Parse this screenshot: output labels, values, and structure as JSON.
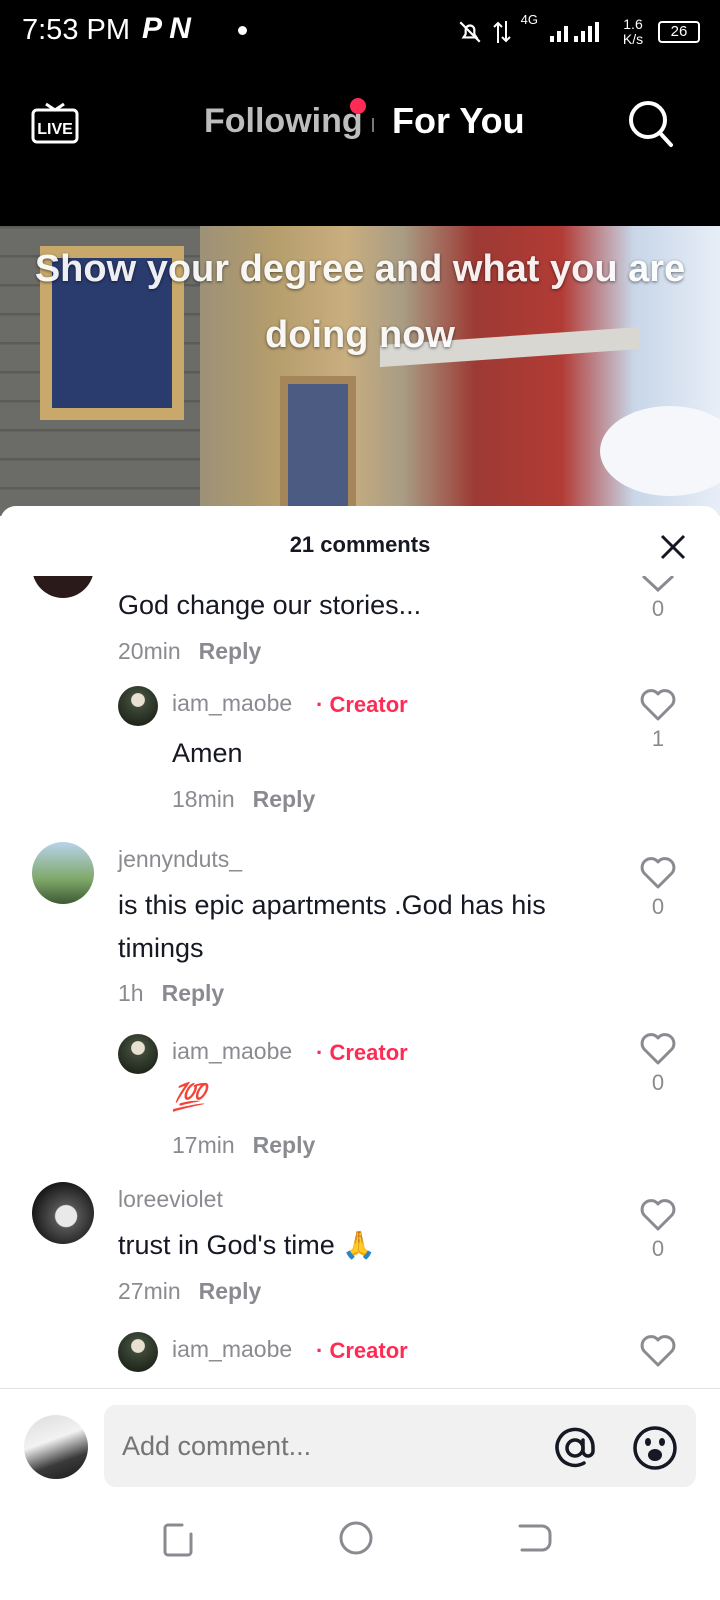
{
  "status_bar": {
    "time": "7:53 PM",
    "app_letters": "P N",
    "network": "4G",
    "speed": "1.6 K/s",
    "battery": "26"
  },
  "header": {
    "live_label": "LIVE",
    "tabs": [
      {
        "label": "Following",
        "active": false,
        "has_dot": true
      },
      {
        "label": "For You",
        "active": true
      }
    ]
  },
  "video": {
    "caption": "Show your degree and what you are doing now"
  },
  "comments_sheet": {
    "title": "21 comments",
    "comments": [
      {
        "username": "",
        "text": "God change our stories...",
        "time": "20min",
        "reply_label": "Reply",
        "likes": "0",
        "is_reply": false
      },
      {
        "username": "iam_maobe",
        "badge": "Creator",
        "text": "Amen",
        "time": "18min",
        "reply_label": "Reply",
        "likes": "1",
        "is_reply": true
      },
      {
        "username": "jennynduts_",
        "text": "is this epic apartments .God has his timings",
        "time": "1h",
        "reply_label": "Reply",
        "likes": "0",
        "is_reply": false
      },
      {
        "username": "iam_maobe",
        "badge": "Creator",
        "text": "💯",
        "time": "17min",
        "reply_label": "Reply",
        "likes": "0",
        "is_reply": true
      },
      {
        "username": "loreeviolet",
        "text": "trust in God's time 🙏",
        "time": "27min",
        "reply_label": "Reply",
        "likes": "0",
        "is_reply": false
      },
      {
        "username": "iam_maobe",
        "badge": "Creator",
        "text": "",
        "time": "",
        "reply_label": "",
        "likes": "",
        "is_reply": true
      }
    ]
  },
  "input": {
    "placeholder": "Add comment..."
  },
  "colors": {
    "accent": "#fe2c55",
    "text": "#161823",
    "muted": "#8a8b91"
  }
}
